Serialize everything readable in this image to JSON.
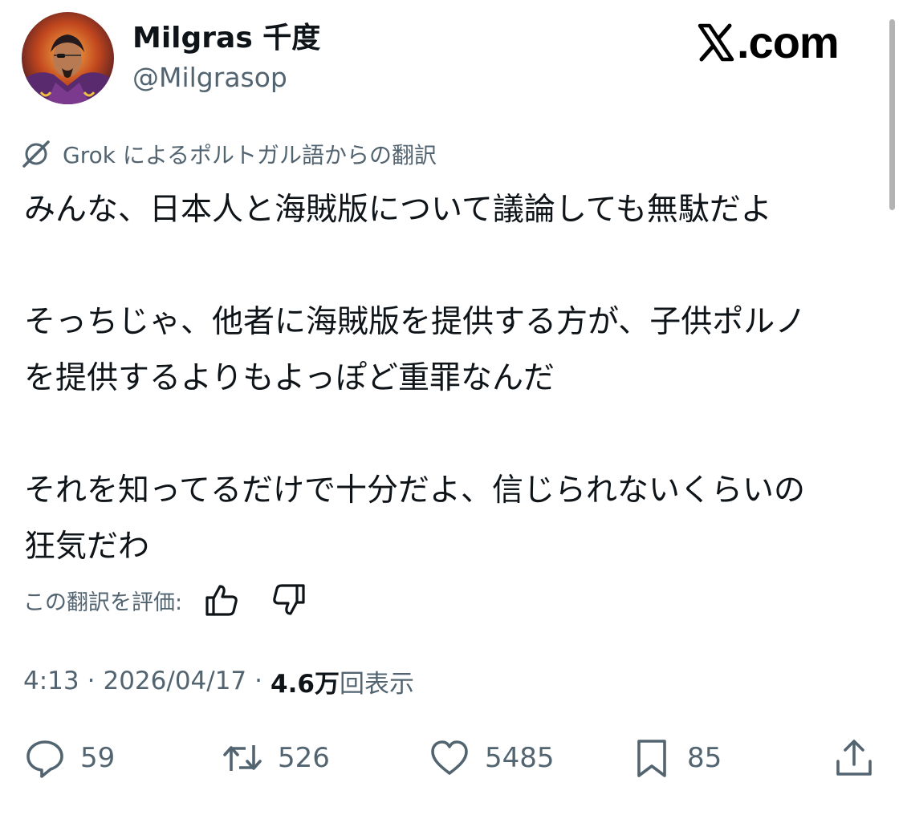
{
  "author": {
    "display_name": "Milgras 千度",
    "handle": "@Milgrasop",
    "avatar_icon": "profile-avatar"
  },
  "watermark": {
    "text": ".com",
    "icon": "x-logo"
  },
  "translation": {
    "note": "Grok によるポルトガル語からの翻訳",
    "icon": "grok-icon"
  },
  "body": {
    "paragraphs": [
      "みんな、日本人と海賊版について議論しても無駄だよ",
      "そっちじゃ、他者に海賊版を提供する方が、子供ポルノ\nを提供するよりもよっぽど重罪なんだ",
      "それを知ってるだけで十分だよ、信じられないくらいの\n狂気だわ"
    ]
  },
  "rating": {
    "label": "この翻訳を評価:",
    "up_icon": "thumbs-up-icon",
    "down_icon": "thumbs-down-icon"
  },
  "meta": {
    "time": "4:13",
    "separator": "·",
    "date": "2026/04/17",
    "views_count": "4.6万",
    "views_label": "回表示"
  },
  "actions": {
    "replies": "59",
    "retweets": "526",
    "likes": "5485",
    "bookmarks": "85"
  },
  "colors": {
    "text": "#0f1419",
    "secondary": "#536471",
    "background": "#ffffff"
  }
}
